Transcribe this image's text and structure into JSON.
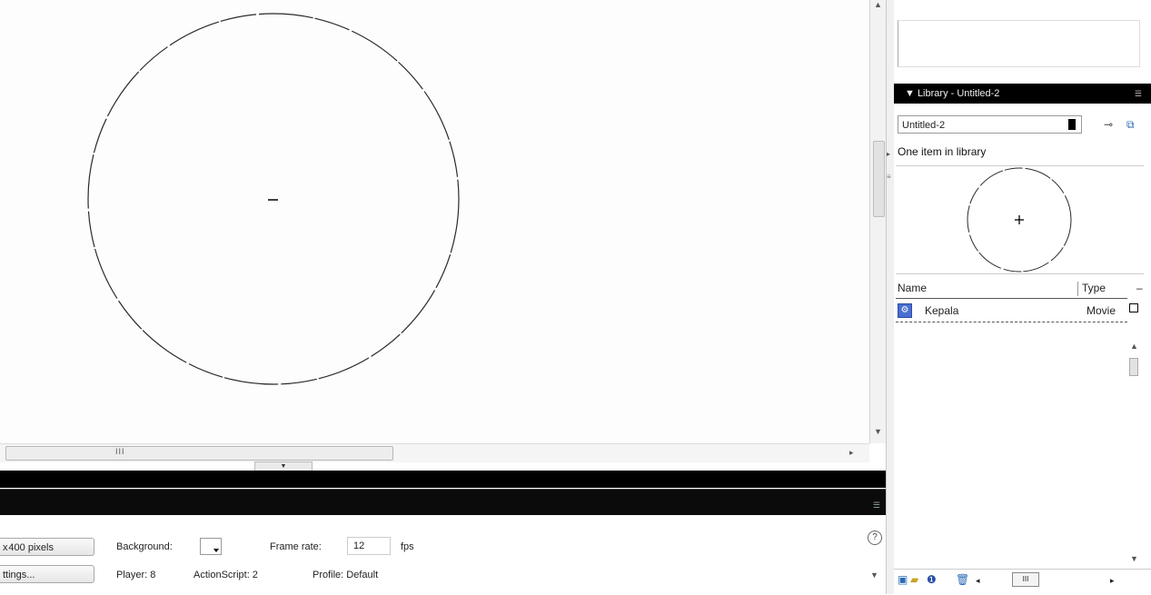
{
  "stage": {
    "scroll_grip": "III"
  },
  "properties": {
    "size_button": " 400 pixels",
    "size_button_prefix": "x",
    "publish_button": "ttings...",
    "background_label": "Background:",
    "frame_rate_label": "Frame rate:",
    "frame_rate_value": "12",
    "fps_label": "fps",
    "player_label": "Player: 8",
    "actionscript_label": "ActionScript: 2",
    "profile_label": "Profile: Default",
    "help_glyph": "?"
  },
  "library": {
    "panel_title": "▼ Library - Untitled-2",
    "document_select": "Untitled-2",
    "item_count": "One item in library",
    "columns": {
      "name": "Name",
      "type": "Type"
    },
    "items": [
      {
        "name": "Kepala",
        "type": "Movie",
        "icon": "movie-clip-icon"
      }
    ],
    "hscroll_grip": "III"
  },
  "colors": {
    "panel_bar": "#000000",
    "stage_bg": "#fdfdfd",
    "symbol_icon": "#4a6ed0"
  }
}
